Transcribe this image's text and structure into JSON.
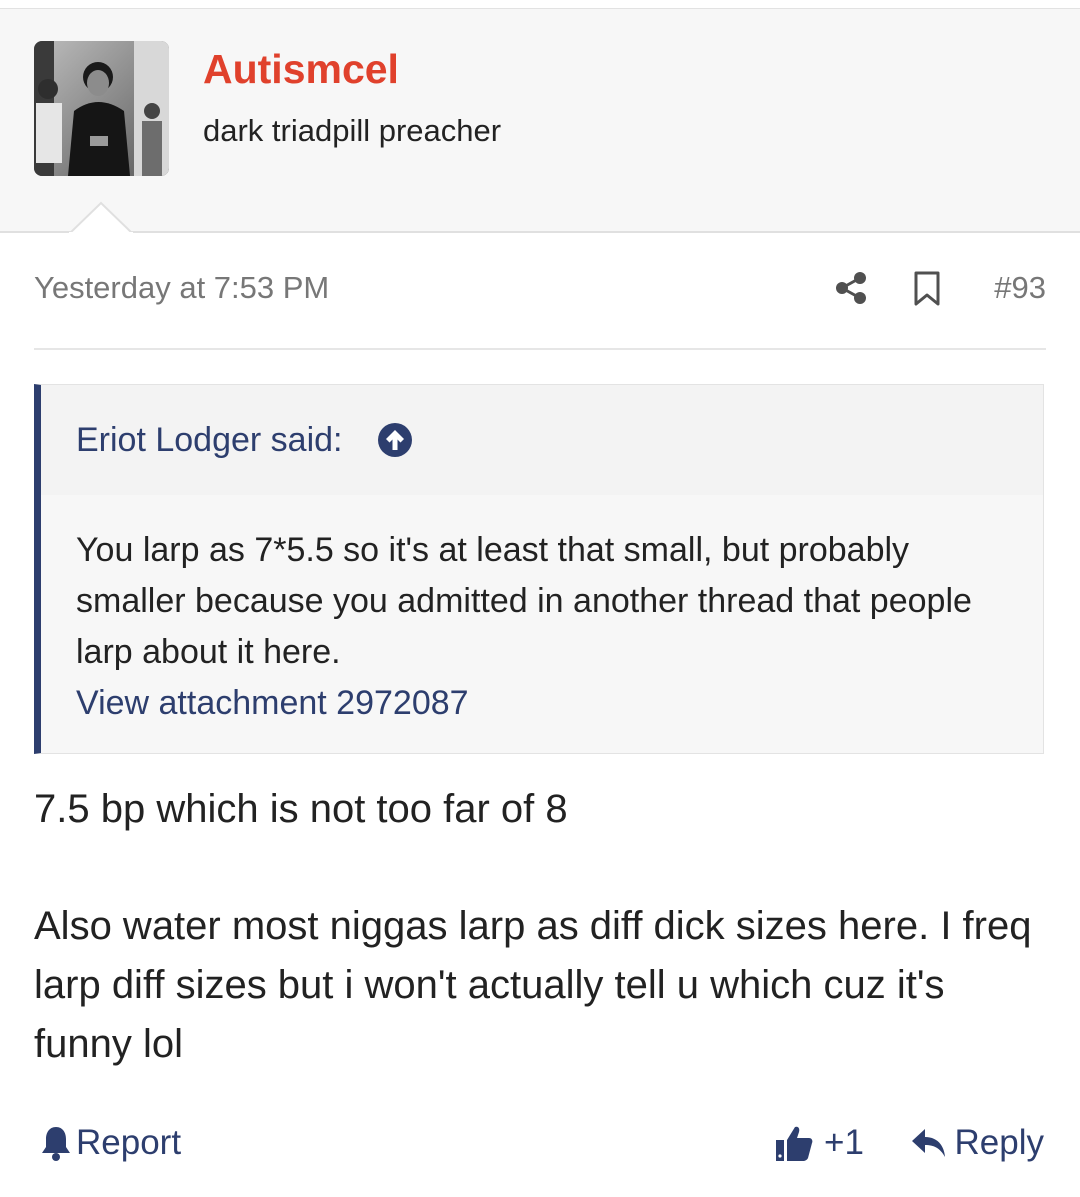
{
  "user": {
    "name": "Autismcel",
    "title": "dark triadpill preacher",
    "name_color": "#e0412c",
    "avatar_icon": "user-avatar-photo"
  },
  "post": {
    "timestamp": "Yesterday at 7:53 PM",
    "number": "#93",
    "share_icon": "share-icon",
    "bookmark_icon": "bookmark-icon",
    "quote": {
      "author": "Eriot Lodger said:",
      "arrow_icon": "arrow-up-circle-icon",
      "text": "You larp as 7*5.5 so it's at least that small, but probably smaller because you admitted in another thread that people larp about it here.",
      "attachment_link": "View attachment 2972087"
    },
    "body": {
      "paragraph1": "7.5 bp which is not too far of 8",
      "paragraph2": "Also water most niggas larp as diff dick sizes here. I freq larp diff sizes but i won't actually tell u which cuz it's funny lol"
    }
  },
  "actions": {
    "report_label": "Report",
    "report_icon": "bell-icon",
    "like_count": "+1",
    "like_icon": "thumbs-up-icon",
    "reply_label": "Reply",
    "reply_icon": "reply-arrow-icon"
  },
  "colors": {
    "accent": "#2d3e6e",
    "header_bg": "#f7f7f7",
    "text": "#222222",
    "muted": "#777777"
  }
}
